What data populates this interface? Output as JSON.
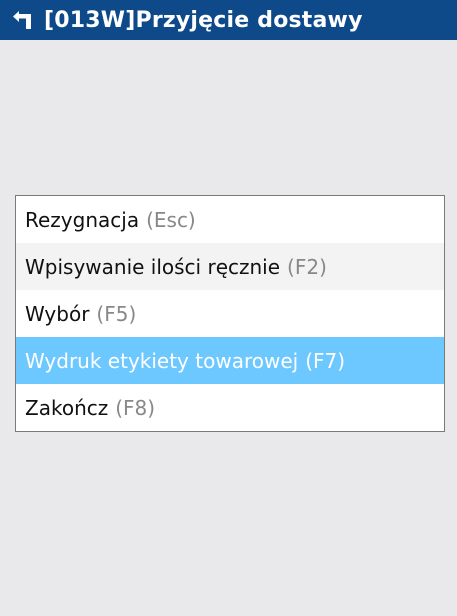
{
  "header": {
    "title": "[013W]Przyjęcie dostawy",
    "back_icon": "return-arrow-icon",
    "background_color": "#0e4a8a"
  },
  "menu": {
    "items": [
      {
        "label": "Rezygnacja",
        "shortcut": "(Esc)"
      },
      {
        "label": "Wpisywanie ilości ręcznie",
        "shortcut": "(F2)"
      },
      {
        "label": "Wybór",
        "shortcut": "(F5)"
      },
      {
        "label": "Wydruk etykiety towarowej",
        "shortcut": "(F7)"
      },
      {
        "label": "Zakończ",
        "shortcut": "(F8)"
      }
    ],
    "selected_label": "Wydruk etykiety towarowej",
    "selected_color": "#6cc8ff"
  }
}
